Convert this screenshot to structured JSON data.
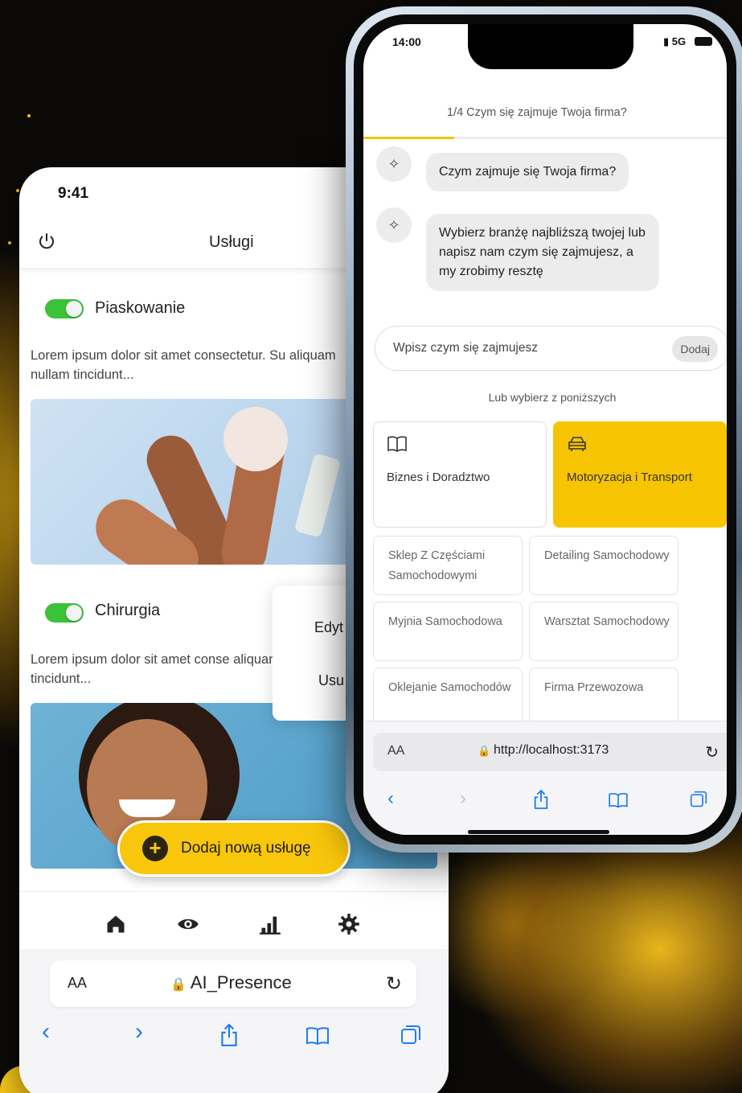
{
  "back_phone": {
    "status_time": "9:41",
    "header_title": "Usługi",
    "services": [
      {
        "name": "Piaskowanie",
        "description": "Lorem ipsum dolor sit amet consectetur. Su aliquam nullam tincidunt...",
        "enabled": true
      },
      {
        "name": "Chirurgia",
        "description": "Lorem ipsum dolor sit amet conse aliquam nullam tincidunt...",
        "enabled": true
      }
    ],
    "context_menu": {
      "edit": "Edyt",
      "delete": "Usu"
    },
    "fab_label": "Dodaj nową usługę",
    "tabbar_icons": [
      "home-icon",
      "eye-icon",
      "stats-icon",
      "gear-icon"
    ],
    "browser": {
      "aa": "AA",
      "site": "AI_Presence"
    }
  },
  "front_phone": {
    "status_time": "14:00",
    "network": "5G",
    "step_label": "1/4 Czym się zajmuje Twoja firma?",
    "progress": 0.25,
    "messages": [
      "Czym zajmuje się Twoja firma?",
      "Wybierz branżę najbliższą twojej lub napisz nam czym się zajmujesz, a my zrobimy resztę"
    ],
    "input": {
      "placeholder": "Wpisz czym się zajmujesz",
      "button": "Dodaj"
    },
    "choose_label": "Lub wybierz z poniższych",
    "categories": [
      {
        "label": "Biznes i Doradztwo",
        "icon": "book-icon",
        "active": false
      },
      {
        "label": "Motoryzacja i Transport",
        "icon": "car-icon",
        "active": true
      }
    ],
    "subcategories": [
      "Sklep Z Częściami Samochodowymi",
      "Detailing Samochodowy",
      "Myjnia Samochodowa",
      "Warsztat Samochodowy",
      "Oklejanie Samochodów",
      "Firma Przewozowa"
    ],
    "browser": {
      "aa": "AA",
      "url": "http://localhost:3173"
    }
  },
  "colors": {
    "accent": "#f6c400",
    "toggle_on": "#3cc13b",
    "link_blue": "#1e7cf2"
  }
}
